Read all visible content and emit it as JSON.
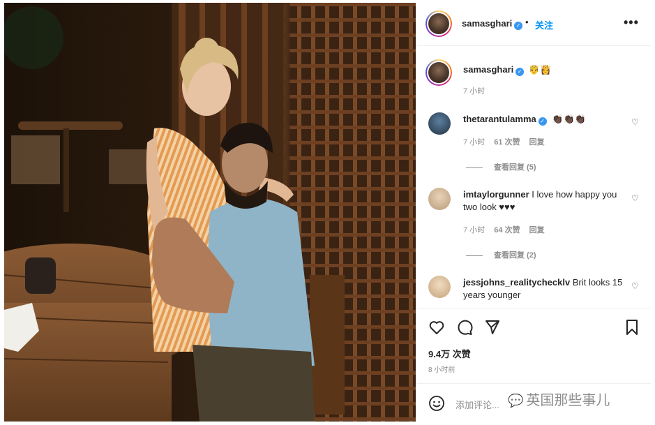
{
  "header": {
    "username": "samasghari",
    "verified_mark": "✓",
    "separator": "•",
    "follow_label": "关注",
    "more_label": "•••"
  },
  "caption": {
    "username": "samasghari",
    "emoji": "🤴👸",
    "time": "7 小时"
  },
  "comments": [
    {
      "username": "thetarantulamma",
      "verified": true,
      "text": "👏🏿👏🏿👏🏿",
      "time": "7 小时",
      "likes": "61 次赞",
      "reply_label": "回复",
      "view_replies": "查看回复 (5)"
    },
    {
      "username": "imtaylorgunner",
      "verified": false,
      "text": "I love how happy you two look ♥♥♥",
      "time": "7 小时",
      "likes": "64 次赞",
      "reply_label": "回复",
      "view_replies": "查看回复 (2)"
    },
    {
      "username": "jessjohns_realitychecklv",
      "verified": false,
      "text": "Brit looks 15 years younger"
    }
  ],
  "stats": {
    "likes": "9.4万 次赞",
    "posted": "8 小时前"
  },
  "comment_box": {
    "placeholder": "添加评论..."
  },
  "watermark": {
    "icon": "💬",
    "text": "英国那些事儿"
  },
  "icons": {
    "like": "heart-icon",
    "comment": "comment-icon",
    "share": "send-icon",
    "save": "bookmark-icon",
    "emoji": "emoji-icon"
  },
  "colors": {
    "accent": "#0095f6",
    "verified": "#3897f0",
    "muted": "#8e8e8e",
    "text": "#262626"
  }
}
